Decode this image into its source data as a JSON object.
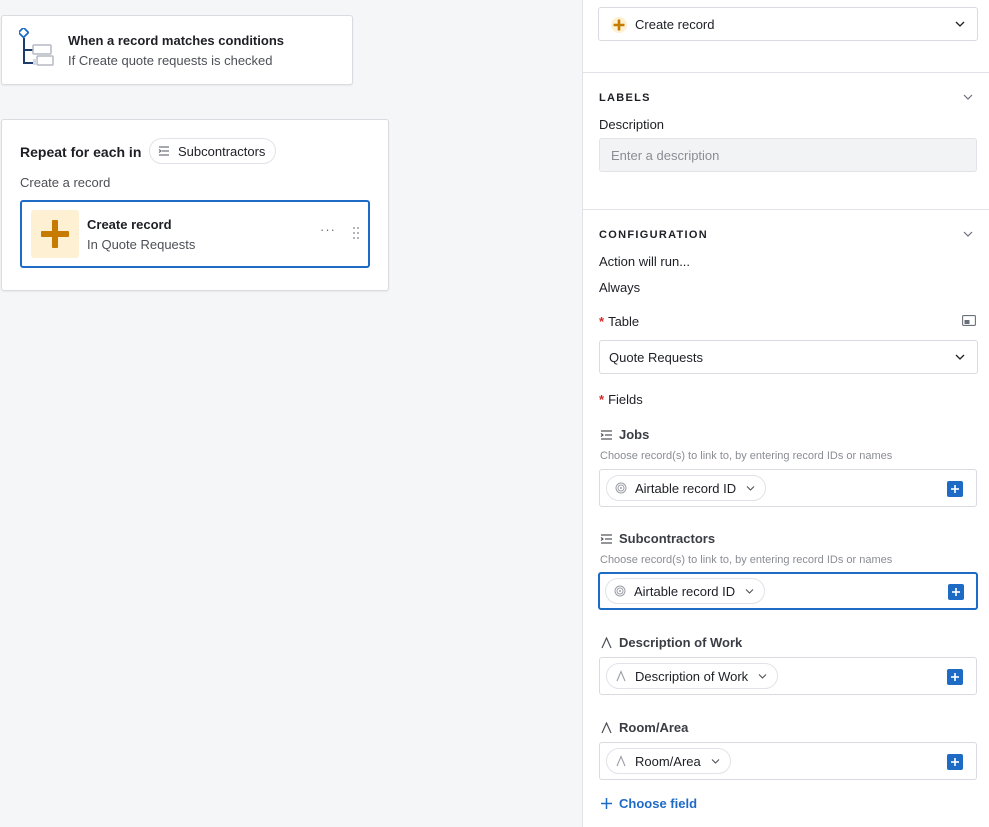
{
  "trigger": {
    "title": "When a record matches conditions",
    "subtitle": "If Create quote requests is checked"
  },
  "repeat": {
    "title": "Repeat for each in",
    "list_name": "Subcontractors",
    "subtitle": "Create a record",
    "action": {
      "title": "Create record",
      "subtitle": "In Quote Requests",
      "more": "···"
    }
  },
  "panel": {
    "action_select": "Create record",
    "labels": {
      "heading": "LABELS",
      "description_label": "Description",
      "description_placeholder": "Enter a description",
      "description_value": ""
    },
    "configuration": {
      "heading": "CONFIGURATION",
      "run_label": "Action will run...",
      "run_value": "Always",
      "table_label": "Table",
      "table_value": "Quote Requests",
      "fields_label": "Fields",
      "required_mark": "*",
      "fields": [
        {
          "name": "Jobs",
          "hint": "Choose record(s) to link to, by entering record IDs or names",
          "token": "Airtable record ID",
          "icon": "linked-record-icon"
        },
        {
          "name": "Subcontractors",
          "hint": "Choose record(s) to link to, by entering record IDs or names",
          "token": "Airtable record ID",
          "icon": "linked-record-icon"
        },
        {
          "name": "Description of Work",
          "hint": "",
          "token": "Description of Work",
          "icon": "text-field-icon"
        },
        {
          "name": "Room/Area",
          "hint": "",
          "token": "Room/Area",
          "icon": "text-field-icon"
        }
      ],
      "choose_field": "Choose field"
    }
  },
  "colors": {
    "accent": "#1e6bc6",
    "action_orange": "#c77a00",
    "action_bg": "#fdf0d3",
    "required": "#d42a2a"
  }
}
